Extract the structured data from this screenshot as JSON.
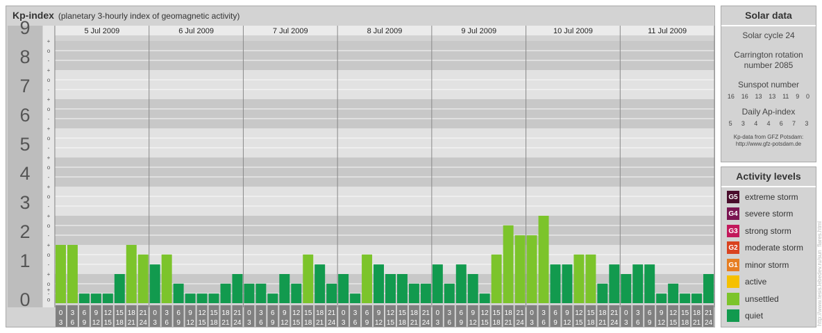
{
  "header": {
    "title": "Kp-index",
    "subtitle": "(planetary 3-hourly index of geomagnetic activity)"
  },
  "chart_data": {
    "type": "bar",
    "title": "Kp-index",
    "subtitle": "(planetary 3-hourly index of geomagnetic activity)",
    "ylim": [
      0,
      9
    ],
    "y_ticks": [
      "0",
      "1",
      "2",
      "3",
      "4",
      "5",
      "6",
      "7",
      "8",
      "9"
    ],
    "sub_ticks": [
      "+",
      "o",
      "-"
    ],
    "days": [
      "5 Jul 2009",
      "6 Jul 2009",
      "7 Jul 2009",
      "8 Jul 2009",
      "9 Jul 2009",
      "10 Jul 2009",
      "11 Jul 2009"
    ],
    "interval_start": [
      "0",
      "3",
      "6",
      "9",
      "12",
      "15",
      "18",
      "21"
    ],
    "interval_end": [
      "3",
      "6",
      "9",
      "12",
      "15",
      "18",
      "21",
      "24"
    ],
    "values": [
      [
        2.0,
        2.0,
        0.33,
        0.33,
        0.33,
        1.0,
        2.0,
        1.67
      ],
      [
        1.33,
        1.67,
        0.67,
        0.33,
        0.33,
        0.33,
        0.67,
        1.0
      ],
      [
        0.67,
        0.67,
        0.33,
        1.0,
        0.67,
        1.67,
        1.33,
        0.67
      ],
      [
        1.0,
        0.33,
        1.67,
        1.33,
        1.0,
        1.0,
        0.67,
        0.67
      ],
      [
        1.33,
        0.67,
        1.33,
        1.0,
        0.33,
        1.67,
        2.67,
        2.33
      ],
      [
        2.33,
        3.0,
        1.33,
        1.33,
        1.67,
        1.67,
        0.67,
        1.33
      ],
      [
        1.0,
        1.33,
        1.33,
        0.33,
        0.67,
        0.33,
        0.33,
        1.0
      ]
    ],
    "grid": true
  },
  "solar": {
    "title": "Solar data",
    "cycle": "Solar cycle 24",
    "carrington_line1": "Carrington rotation",
    "carrington_line2": "number 2085",
    "sunspot_label": "Sunspot number",
    "sunspot_values": [
      "16",
      "16",
      "13",
      "13",
      "11",
      "9",
      "0"
    ],
    "ap_label": "Daily Ap-index",
    "ap_values": [
      "5",
      "3",
      "4",
      "4",
      "6",
      "7",
      "3"
    ],
    "source_line1": "Kp-data from GFZ Potsdam:",
    "source_line2": "http://www.gfz-potsdam.de"
  },
  "activity": {
    "title": "Activity levels",
    "levels": [
      {
        "code": "G5",
        "label": "extreme storm",
        "color": "#4a0d2c"
      },
      {
        "code": "G4",
        "label": "severe storm",
        "color": "#7a1451"
      },
      {
        "code": "G3",
        "label": "strong storm",
        "color": "#c2185b"
      },
      {
        "code": "G2",
        "label": "moderate storm",
        "color": "#d9421f"
      },
      {
        "code": "G1",
        "label": "minor storm",
        "color": "#e67e22"
      },
      {
        "code": "",
        "label": "active",
        "color": "#f5c000"
      },
      {
        "code": "",
        "label": "unsettled",
        "color": "#7cc42b"
      },
      {
        "code": "",
        "label": "quiet",
        "color": "#129a4e"
      }
    ]
  },
  "credit": "http://www.tesis.lebedev.ru/sun_flares.html"
}
